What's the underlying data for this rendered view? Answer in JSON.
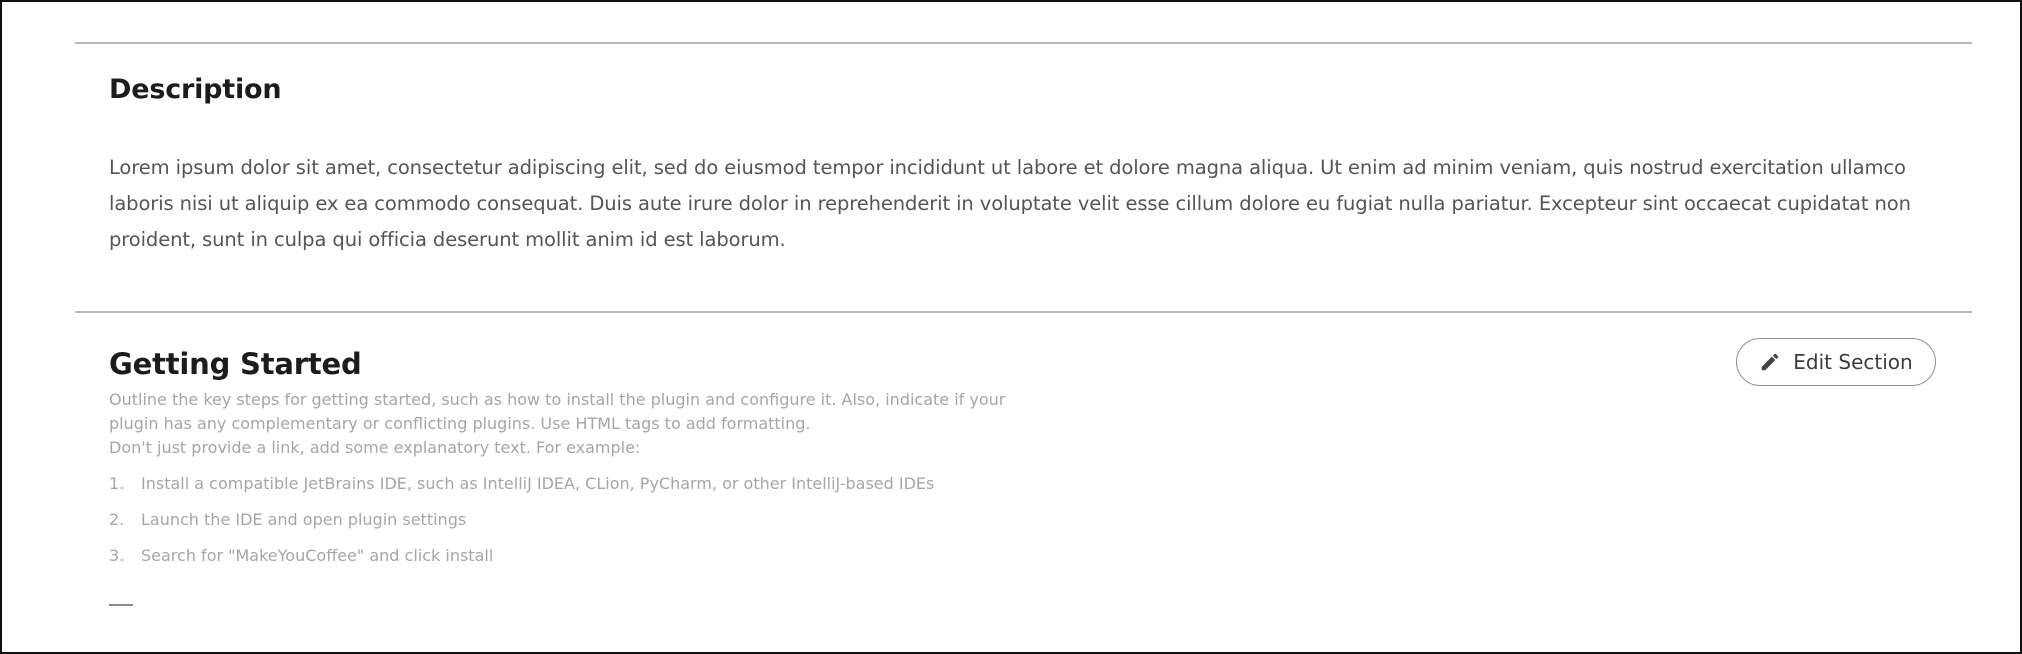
{
  "description": {
    "title": "Description",
    "body": "Lorem ipsum dolor sit amet, consectetur adipiscing elit, sed do eiusmod tempor incididunt ut labore et dolore magna aliqua. Ut enim ad minim veniam, quis nostrud exercitation ullamco laboris nisi ut aliquip ex ea commodo consequat. Duis aute irure dolor in reprehenderit in voluptate velit esse cillum dolore eu fugiat nulla pariatur. Excepteur sint occaecat cupidatat non proident, sunt in culpa qui officia deserunt mollit anim id est laborum."
  },
  "getting_started": {
    "title": "Getting Started",
    "edit_button_label": "Edit Section",
    "edit_button_icon": "pencil-icon",
    "hint_line_1": "Outline the key steps for getting started, such as how to install the plugin and configure it. Also, indicate if your plugin has any complementary or conflicting plugins. Use HTML tags to add formatting.",
    "hint_line_2": "Don't just provide a link, add some explanatory text. For example:",
    "steps": [
      {
        "num": "1.",
        "text": "Install a compatible JetBrains IDE, such as IntelliJ IDEA, CLion, PyCharm, or other IntelliJ-based IDEs"
      },
      {
        "num": "2.",
        "text": "Launch the IDE and open plugin settings"
      },
      {
        "num": "3.",
        "text": "Search for \"MakeYouCoffee\" and click install"
      }
    ],
    "trailing_mark": "—"
  }
}
